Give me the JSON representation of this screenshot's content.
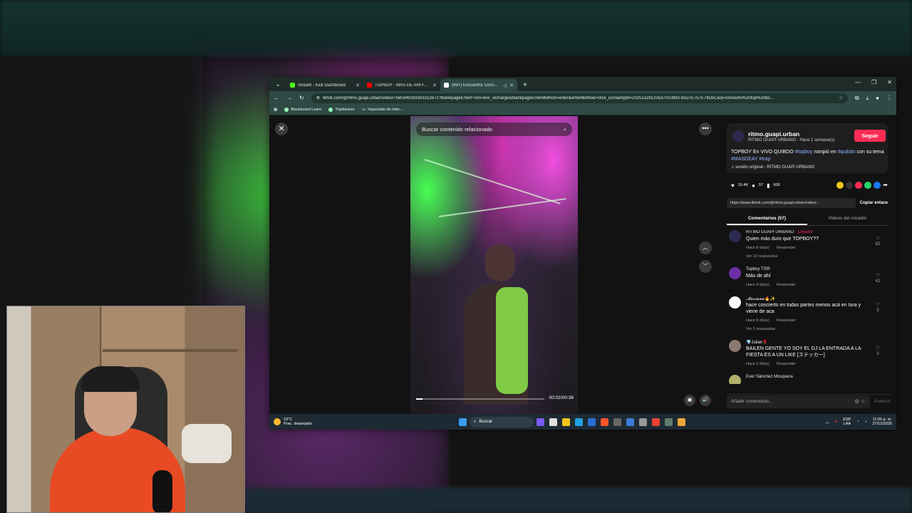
{
  "browser": {
    "tabs": [
      {
        "title": "Stream - Kick Dashboard",
        "favicon_color": "#53fc18"
      },
      {
        "title": "TOPBOY - MÁS DE AHÍ FT KZA...",
        "favicon_color": "#ff0000"
      },
      {
        "title": "(99+) Encuentra 'concierto...",
        "favicon_color": "#ffffff"
      }
    ],
    "url": "tiktok.com/@ritmo.guapi.urban/video/7585949193303313671?blankpageEnterFrom=live_recharge&blankpageEnterMethod=enter&enterMethod=click_icon&impId=20251228120537010893 65D7E757E79D5C&q=concierto%20top%20bo...",
    "bookmarks": [
      "Blackboard Learn",
      "TripAdvisor",
      "Importado de Inter..."
    ]
  },
  "video": {
    "search_placeholder": "Buscar contenido relacionado",
    "timecode": "00:02/00:38",
    "progress": 0.05
  },
  "post": {
    "username": "ritmo.guapi.urban",
    "subline": "RITMO GUAPI URBANO · Hace 1 semana(s)",
    "follow_label": "Seguir",
    "desc_prefix": "TOPBOY En VIVO QUIBDO",
    "tag1": "#topboy",
    "desc_mid": "rompió en",
    "tag2": "#quibdo",
    "desc_mid2": "con su tema",
    "tag3": "#MASDEAY",
    "tag4": "#trap",
    "sound": "sonido original - RITMO GUAPI URBANO",
    "likes": "10.4K",
    "comments_count": "57",
    "saves": "606",
    "share_link": "https://www.tiktok.com/@ritmo.guapi.urban/video/...",
    "copy_link_label": "Copiar enlace",
    "tab_comments": "Comentarios (57)",
    "tab_creator": "Videos del creador"
  },
  "comments": [
    {
      "user": "RITMO GUAPI URBANO",
      "badge": "· Creador",
      "text": "Quien más duro que TOPBOY??",
      "date": "Hace 6 día(s)",
      "reply": "Responder",
      "replies": "Ver 10 respuestas",
      "likes": "62",
      "avatar_color": "#2c2a4e"
    },
    {
      "user": "Topboy TGR",
      "badge": "",
      "text": "Más de ahí",
      "date": "Hace 4 día(s)",
      "reply": "Responder",
      "replies": "",
      "likes": "42",
      "avatar_color": "#6d2fa8"
    },
    {
      "user": "𝓜𝓪𝓻𝓲𝓪𝓷𝓪🔥✨",
      "badge": "",
      "text": "hace concierto en todas partes menos acá en tura y viene de aca",
      "date": "Hace 6 día(s)",
      "reply": "Responder",
      "replies": "Ver 5 respuestas",
      "likes": "5",
      "avatar_color": "#ffffff"
    },
    {
      "user": "💎Julian🌹",
      "badge": "",
      "text": "BAILEN GENTE YO SOY EL DJ LA ENTRADA A LA FIESTA ES A UN LIKE [ステッカー]",
      "date": "Hace 3 día(s)",
      "reply": "Responder",
      "replies": "",
      "likes": "3",
      "avatar_color": "#8a7a70"
    },
    {
      "user": "Ever Sánchez Mosquera",
      "badge": "",
      "text": "",
      "date": "",
      "reply": "",
      "replies": "",
      "likes": "",
      "avatar_color": "#b0b06a"
    }
  ],
  "add_comment": {
    "placeholder": "Añadir comentario...",
    "publish": "Publicar"
  },
  "taskbar": {
    "temp": "19°C",
    "weather": "Prac. despejado",
    "search": "Buscar",
    "lang": "ESP",
    "lang2": "LAA",
    "time": "11:05 p. m.",
    "date": "27/12/2025"
  }
}
